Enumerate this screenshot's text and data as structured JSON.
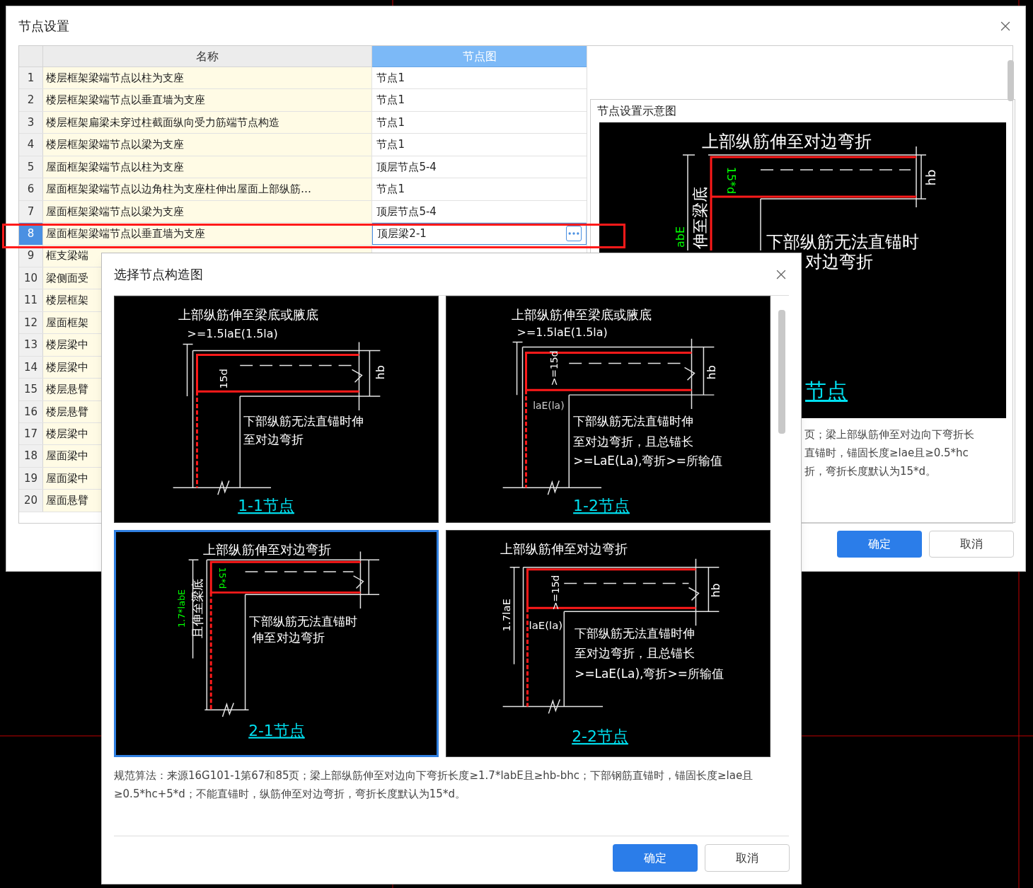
{
  "window": {
    "title": "节点设置"
  },
  "table": {
    "columns": [
      "名称",
      "节点图"
    ],
    "rows": [
      {
        "index": "1",
        "name": "楼层框架梁端节点以柱为支座",
        "node": "节点1",
        "selected": false
      },
      {
        "index": "2",
        "name": "楼层框架梁端节点以垂直墙为支座",
        "node": "节点1",
        "selected": false
      },
      {
        "index": "3",
        "name": "楼层框架扁梁未穿过柱截面纵向受力筋端节点构造",
        "node": "节点1",
        "selected": false
      },
      {
        "index": "4",
        "name": "楼层框架梁端节点以梁为支座",
        "node": "节点1",
        "selected": false
      },
      {
        "index": "5",
        "name": "屋面框架梁端节点以柱为支座",
        "node": "顶层节点5-4",
        "selected": false
      },
      {
        "index": "6",
        "name": "屋面框架梁端节点以边角柱为支座柱伸出屋面上部纵筋…",
        "node": "节点1",
        "selected": false
      },
      {
        "index": "7",
        "name": "屋面框架梁端节点以梁为支座",
        "node": "顶层节点5-4",
        "selected": false
      },
      {
        "index": "8",
        "name": "屋面框架梁端节点以垂直墙为支座",
        "node": "顶层梁2-1",
        "selected": true
      },
      {
        "index": "9",
        "name": "框支梁端",
        "selected": false
      },
      {
        "index": "10",
        "name": "梁侧面受",
        "selected": false
      },
      {
        "index": "11",
        "name": "楼层框架",
        "selected": false
      },
      {
        "index": "12",
        "name": "屋面框架",
        "selected": false
      },
      {
        "index": "13",
        "name": "楼层梁中",
        "selected": false
      },
      {
        "index": "14",
        "name": "楼层梁中",
        "selected": false
      },
      {
        "index": "15",
        "name": "楼层悬臂",
        "selected": false
      },
      {
        "index": "16",
        "name": "楼层悬臂",
        "selected": false
      },
      {
        "index": "17",
        "name": "楼层梁中",
        "selected": false
      },
      {
        "index": "18",
        "name": "屋面梁中",
        "selected": false
      },
      {
        "index": "19",
        "name": "屋面梁中",
        "selected": false
      },
      {
        "index": "20",
        "name": "屋面悬臂",
        "selected": false
      }
    ]
  },
  "preview": {
    "title": "节点设置示意图",
    "drawing_labels": [
      "上部纵筋伸至对边弯折",
      "伸至梁底",
      "15*d",
      "abE",
      "下部纵筋无法直锚时",
      "对边弯折",
      "节点",
      "hb"
    ],
    "description_lines": [
      "页；梁上部纵筋伸至对边向下弯折长",
      "直锚时，锚固长度≥lae且≥0.5*hc",
      "折，弯折长度默认为15*d。"
    ]
  },
  "buttons": [
    "确定",
    "取消"
  ],
  "picker": {
    "title": "选择节点构造图",
    "options": [
      {
        "kind": "bottom-bend",
        "selected": false,
        "heading": "上部纵筋伸至梁底或腋底",
        "subheading": ">=1.5laE(1.5la)",
        "dims": [
          "15d",
          "hb"
        ],
        "note_lines": [
          "下部纵筋无法直锚时伸",
          "至对边弯折"
        ],
        "caption": "1-1节点"
      },
      {
        "kind": "bottom-bend-anchored",
        "selected": false,
        "heading": "上部纵筋伸至梁底或腋底",
        "subheading": ">=1.5laE(1.5la)",
        "dims": [
          ">=15d",
          "hb",
          "laE(la)"
        ],
        "note_lines": [
          "下部纵筋无法直锚时伸",
          "至对边弯折，且总锚长",
          ">=LaE(La),弯折>=所输值"
        ],
        "caption": "1-2节点"
      },
      {
        "kind": "opposite-bend",
        "selected": true,
        "heading": "上部纵筋伸至对边弯折",
        "dims": [
          "1.7*labE",
          "且伸至梁底",
          "15*d"
        ],
        "note_lines": [
          "下部纵筋无法直锚时",
          "伸至对边弯折"
        ],
        "caption": "2-1节点"
      },
      {
        "kind": "opposite-bend-anchored",
        "selected": false,
        "heading": "上部纵筋伸至对边弯折",
        "dims": [
          "1.7laE",
          ">=15d",
          "laE(la)",
          "hb"
        ],
        "note_lines": [
          "下部纵筋无法直锚时伸",
          "至对边弯折，且总锚长",
          ">=LaE(La),弯折>=所输值"
        ],
        "caption": "2-2节点"
      }
    ],
    "description": "规范算法：来源16G101-1第67和85页；梁上部纵筋伸至对边向下弯折长度≥1.7*labE且≥hb-bhc；下部钢筋直锚时，锚固长度≥lae且≥0.5*hc+5*d；不能直锚时，纵筋伸至对边弯折，弯折长度默认为15*d。",
    "buttons": [
      "确定",
      "取消"
    ]
  }
}
